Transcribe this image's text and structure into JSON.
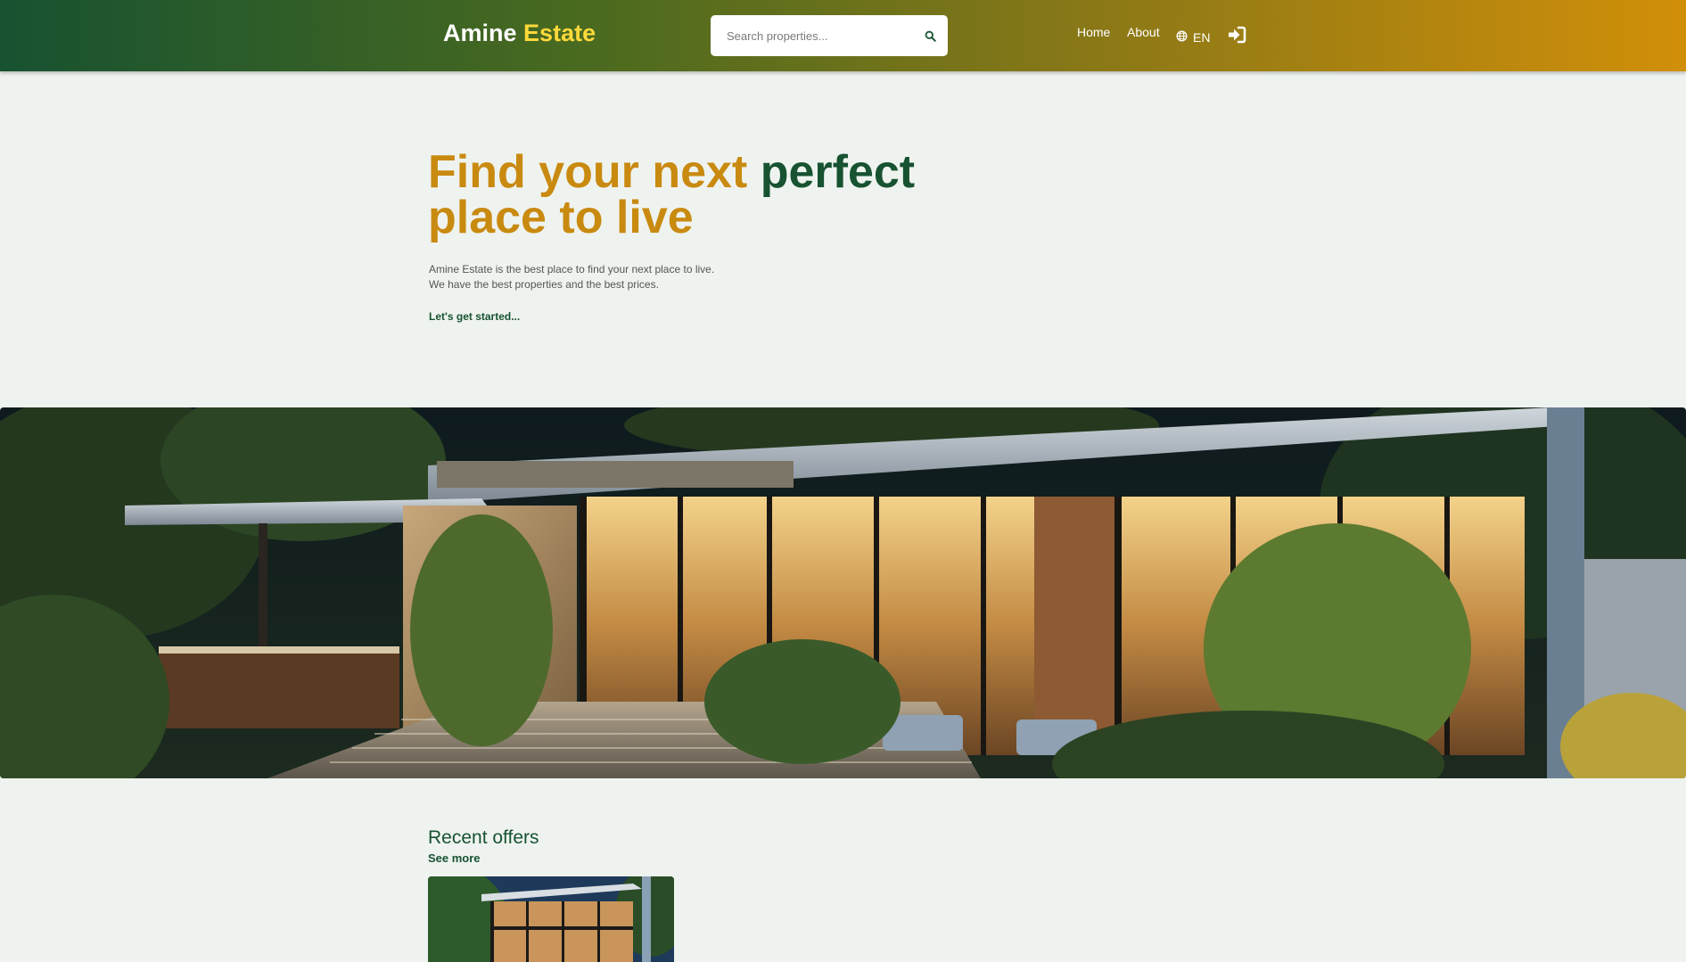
{
  "header": {
    "logo_primary": "Amine",
    "logo_accent": "Estate",
    "search_placeholder": "Search properties...",
    "nav": {
      "home": "Home",
      "about": "About",
      "language": "EN"
    },
    "icons": {
      "search": "search-icon",
      "language": "globe-icon",
      "login": "sign-in-icon"
    }
  },
  "hero": {
    "title_part1": "Find your next",
    "title_part2": "perfect",
    "title_part3": "place to live",
    "description_line1": "Amine Estate is the best place to find your next place to live.",
    "description_line2": "We have the best properties and the best prices.",
    "cta": "Let's get started..."
  },
  "recent": {
    "title": "Recent offers",
    "see_more": "See more"
  },
  "colors": {
    "brand_green": "#175231",
    "brand_gold": "#c98a10",
    "logo_accent": "#ffd93b",
    "background": "#eff3ef"
  }
}
